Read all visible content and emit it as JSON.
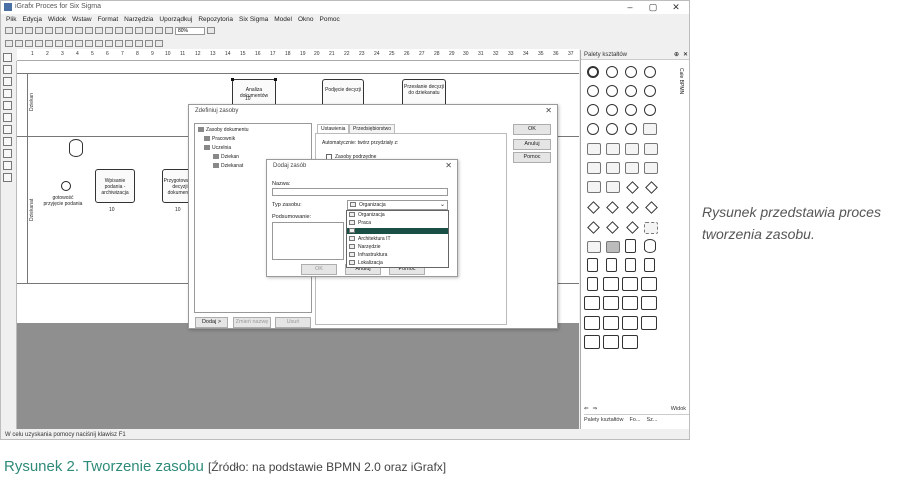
{
  "window": {
    "title": "iGrafx Proces for Six Sigma"
  },
  "menu": [
    "Plik",
    "Edycja",
    "Widok",
    "Wstaw",
    "Format",
    "Narzędzia",
    "Uporządkuj",
    "Repozytoria",
    "Six Sigma",
    "Model",
    "Okno",
    "Pomoc"
  ],
  "toolbar": {
    "zoom": "80%"
  },
  "ruler": [
    "1",
    "2",
    "3",
    "4",
    "5",
    "6",
    "7",
    "8",
    "9",
    "10",
    "11",
    "12",
    "13",
    "14",
    "15",
    "16",
    "17",
    "18",
    "19",
    "20",
    "21",
    "22",
    "23",
    "24",
    "25",
    "26",
    "27",
    "28",
    "29",
    "30",
    "31",
    "32",
    "33",
    "34",
    "35",
    "36",
    "37"
  ],
  "canvas": {
    "lanes": [
      "Dziekan",
      "Dziekanat"
    ],
    "shapes": {
      "analiza": "Analiza dokumentów",
      "podjecie": "Podjęcie decyzji",
      "przeslanie": "Przesłanie decyzji do dziekanatu",
      "wpisanie": "Wpisanie podania - archiwizacja",
      "przygotowanie": "Przygotowanie decyzji dokumentu",
      "gotowosc": "gotowość przyjęcie podania",
      "label_10": "10"
    }
  },
  "statusbar": "W celu uzyskania pomocy naciśnij klawisz F1",
  "palette": {
    "title": "Palety kształtów",
    "side_tab": "Całe BPMN",
    "widok": "Widok",
    "bottom_tabs": [
      "Palety kształtów",
      "Fo...",
      "Sz..."
    ]
  },
  "dialog_resources": {
    "title": "Zdefiniuj zasoby",
    "tree": {
      "root": "Zasoby dokumentu",
      "items": [
        "Pracownik",
        "Uczelnia",
        "Dziekan",
        "Dziekanat"
      ]
    },
    "tabs": [
      "Ustawienia",
      "Przedsiębiorstwo"
    ],
    "auto_label": "Automatycznie: twórz przydziały z:",
    "checkbox_label": "Zasoby podrzędne",
    "buttons": {
      "ok": "OK",
      "cancel": "Anuluj",
      "help": "Pomoc",
      "add": "Dodaj >",
      "rename": "Zmień nazwę",
      "delete": "Usuń"
    }
  },
  "dialog_add": {
    "title": "Dodaj zasób",
    "name_label": "Nazwa:",
    "type_label": "Typ zasobu:",
    "type_value": "Organizacja",
    "sub_label": "Podsumowanie:",
    "ok": "OK",
    "cancel": "Anuluj",
    "help": "Pomoc",
    "options": [
      "Organizacja",
      "Praca",
      "Aplikacja",
      "Architektura IT",
      "Narzędzie",
      "Infrastruktura",
      "Lokalizacja"
    ]
  },
  "side_caption": "Rysunek przedstawia proces tworzenia zasobu.",
  "figure_caption": {
    "title": "Rysunek 2. Tworzenie zasobu",
    "source": "[Źródło: na podstawie BPMN 2.0 oraz iGrafx]"
  }
}
